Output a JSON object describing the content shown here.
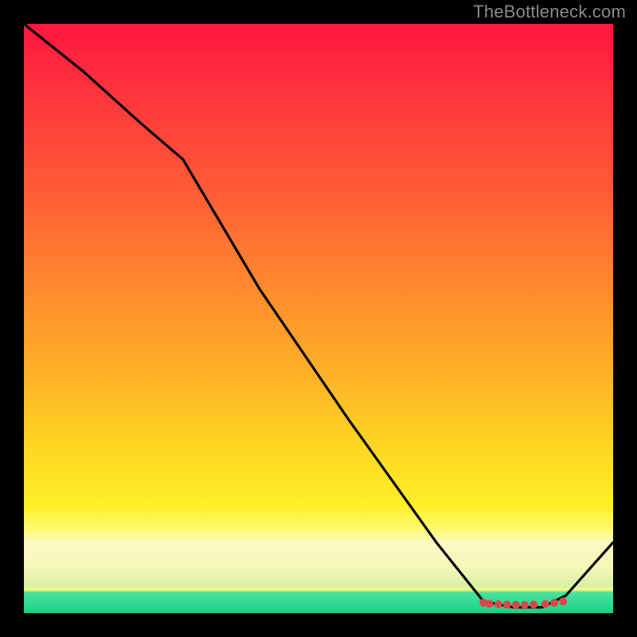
{
  "watermark": "TheBottleneck.com",
  "chart_data": {
    "type": "line",
    "title": "",
    "xlabel": "",
    "ylabel": "",
    "xlim": [
      0,
      100
    ],
    "ylim": [
      0,
      100
    ],
    "series": [
      {
        "name": "curve",
        "x": [
          0,
          10,
          20,
          27,
          40,
          55,
          70,
          78,
          83,
          88,
          92,
          100
        ],
        "values": [
          100,
          92,
          83,
          77,
          55,
          33,
          12,
          2,
          1,
          1,
          3,
          12
        ]
      }
    ],
    "markers": {
      "name": "bottom-cluster",
      "x": [
        78,
        79,
        80.5,
        82,
        83.5,
        85,
        86.5,
        88.5,
        90,
        91.5
      ],
      "values": [
        1.8,
        1.6,
        1.5,
        1.45,
        1.4,
        1.4,
        1.45,
        1.55,
        1.75,
        2.0
      ],
      "color": "#d44a4a",
      "radius": 5
    },
    "gradient_stops": [
      {
        "pos": 0.0,
        "color": "#ff163f"
      },
      {
        "pos": 0.45,
        "color": "#ff8a2e"
      },
      {
        "pos": 0.82,
        "color": "#fff02a"
      },
      {
        "pos": 0.9,
        "color": "#fbf9c4"
      },
      {
        "pos": 0.97,
        "color": "#4be39e"
      },
      {
        "pos": 1.0,
        "color": "#1ecb84"
      }
    ]
  }
}
